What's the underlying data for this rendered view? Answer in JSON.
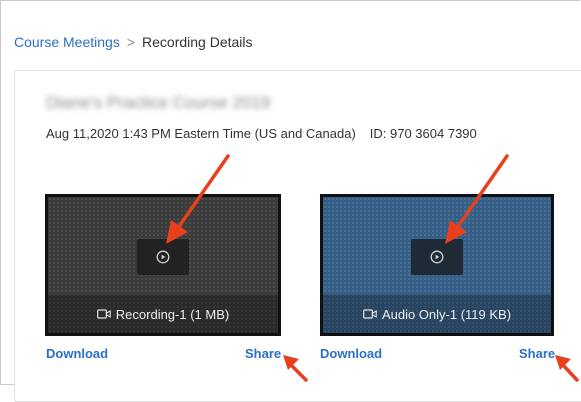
{
  "breadcrumb": {
    "parent": "Course Meetings",
    "separator": ">",
    "current": "Recording Details"
  },
  "course": {
    "title": "Diane's Practice Course 2019",
    "datetime": "Aug 11,2020 1:43 PM Eastern Time (US and Canada)",
    "meeting_id": "ID: 970 3604 7390"
  },
  "recordings": [
    {
      "label": "Recording-1 (1 MB)",
      "download": "Download",
      "share": "Share",
      "type": "video"
    },
    {
      "label": "Audio Only-1 (119 KB)",
      "download": "Download",
      "share": "Share",
      "type": "audio"
    }
  ],
  "colors": {
    "link": "#2d6fc7",
    "annotation_arrow": "#e8401c",
    "video_card_bg": "#3b3b3b",
    "audio_card_bg": "#365f87"
  },
  "icons": {
    "play": "play-circle-icon",
    "camera": "video-camera-icon",
    "arrow": "red-annotation-arrow"
  }
}
